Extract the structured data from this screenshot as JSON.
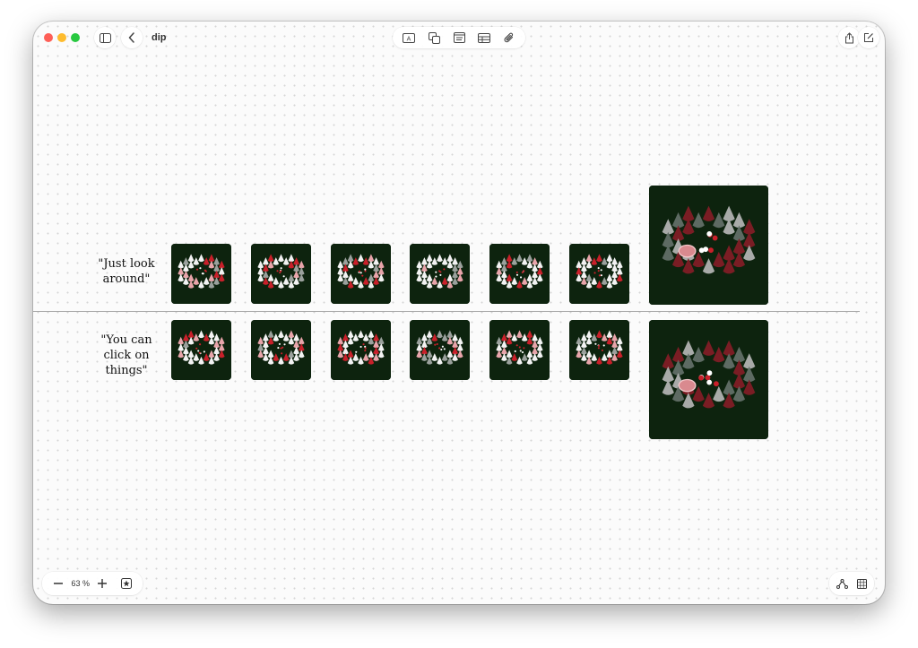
{
  "window": {
    "title": "dip"
  },
  "rows": [
    {
      "label_line1": "\"Just look",
      "label_line2": "around\""
    },
    {
      "label_line1": "\"You can",
      "label_line2": "click on",
      "label_line3": "things\""
    }
  ],
  "zoom": {
    "level": "63 %"
  },
  "colors": {
    "scene_background": "#0d230e",
    "accent_red": "#c8202a"
  },
  "icons": {
    "sidebar": "sidebar-icon",
    "back": "chevron-left-icon",
    "text": "text-box-icon",
    "shapes": "shapes-icon",
    "note": "sticky-note-icon",
    "table": "table-icon",
    "attach": "paperclip-icon",
    "share": "share-icon",
    "edit": "compose-icon",
    "zoom_out": "minus-icon",
    "zoom_in": "plus-icon",
    "favorite": "star-box-icon",
    "connect": "connector-icon",
    "grid": "grid-icon"
  }
}
